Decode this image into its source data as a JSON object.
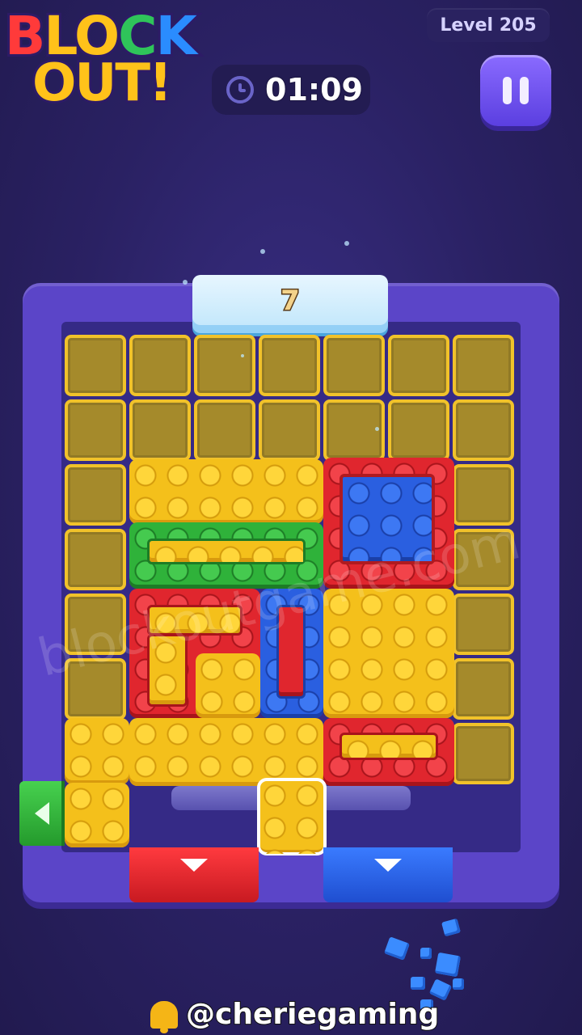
{
  "header": {
    "logo_line1": [
      "B",
      "L",
      "O",
      "C",
      "K"
    ],
    "logo_line2": "OUT!",
    "level": "Level 205",
    "timer": "01:09",
    "pause_icon": "pause-icon",
    "clock_icon": "clock-icon"
  },
  "board": {
    "gate_top_count": "7",
    "gates": [
      {
        "side": "top",
        "color": "#cfeeff"
      },
      {
        "side": "left",
        "color": "#2fb23a",
        "icon": "arrow-left-icon"
      },
      {
        "side": "bottom",
        "color": "#e0262e",
        "icon": "arrow-down-icon"
      },
      {
        "side": "bottom",
        "color": "#2a5fe0",
        "icon": "arrow-down-icon"
      }
    ],
    "block_colors": [
      "yellow",
      "red",
      "blue",
      "green"
    ]
  },
  "watermark": "blockoutgame.com",
  "credit": "@cheriegaming"
}
